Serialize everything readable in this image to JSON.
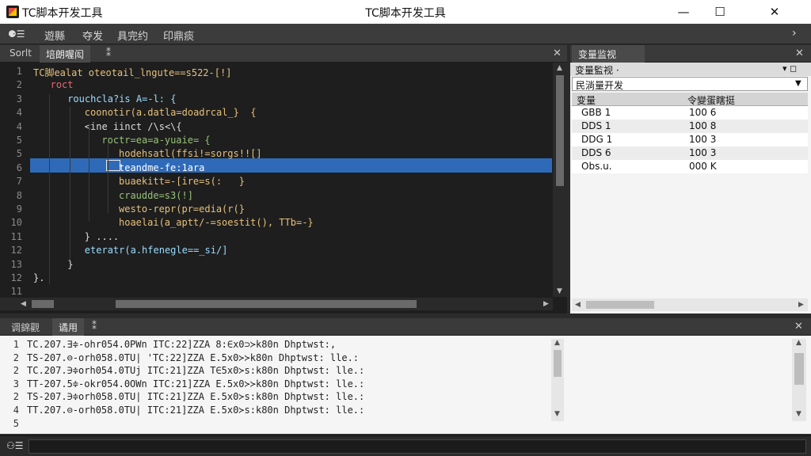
{
  "window": {
    "title_left": "TC脚本开发工具",
    "title_center": "TC脚本开发工具",
    "min_glyph": "—",
    "max_glyph": "☐",
    "close_glyph": "✕"
  },
  "menu": {
    "icon_glyph": "⚈☰",
    "items": [
      "遊縣",
      "夺发",
      "具完约",
      "印鼎痰"
    ],
    "more_glyph": "›"
  },
  "editor": {
    "tabs": [
      "Sorlt",
      "培朗喔闳"
    ],
    "tab_extra": "⁑",
    "close_glyph": "✕",
    "line_numbers": [
      "1",
      "2",
      "3",
      "4",
      "4",
      "5",
      "5",
      "6",
      "7",
      "8",
      "9",
      "10",
      "11",
      "12",
      "13",
      "12",
      "11",
      "21"
    ],
    "lines": [
      {
        "text": "TC脚ealat oteotail_lngute==s522-[!]",
        "indent": 0,
        "color": "#e6c07b"
      },
      {
        "text": "roct",
        "indent": 2,
        "color": "#e06c75"
      },
      {
        "text": "rouchcla?is A=-l: {",
        "indent": 4,
        "color": "#9cdcfe"
      },
      {
        "text": "coonotir(a.datla=doadrcal_}  {",
        "indent": 6,
        "color": "#e6c07b"
      },
      {
        "text": "<ine iinct /\\s<\\{",
        "indent": 6,
        "color": "#ddd"
      },
      {
        "text": "roctr=ea=a-yuaie= {",
        "indent": 8,
        "color": "#98c379"
      },
      {
        "text": "hodehsatl(ffsi!=sorgs!![]",
        "indent": 10,
        "color": "#e6c07b"
      },
      {
        "text": "teandme-fe:1ara",
        "indent": 10,
        "color": "#ffffff"
      },
      {
        "text": "buaekitt=-[ire=s(:   }",
        "indent": 10,
        "color": "#e6c07b"
      },
      {
        "text": "craudde=s3(!]",
        "indent": 10,
        "color": "#98c379"
      },
      {
        "text": "westo-repr(pr=edia(r(}",
        "indent": 10,
        "color": "#e6c07b"
      },
      {
        "text": "hoaelai(a_aptt/-=soestit(), TTb=-}",
        "indent": 10,
        "color": "#e6c07b"
      },
      {
        "text": "} ....",
        "indent": 6,
        "color": "#ddd"
      },
      {
        "text": "eteratr(a.hfenegle==_si/]",
        "indent": 6,
        "color": "#9cdcfe"
      },
      {
        "text": "}",
        "indent": 4,
        "color": "#ddd"
      },
      {
        "text": "}.",
        "indent": 0,
        "color": "#ddd"
      },
      {
        "text": "",
        "indent": 0,
        "color": "#ddd"
      },
      {
        "text": "",
        "indent": 0,
        "color": "#ddd"
      }
    ]
  },
  "variables": {
    "tab_title": "变量监视",
    "close_glyph": "✕",
    "header_label": "变量監视 ·",
    "header_pin": "▾ ◻",
    "selected": "民淌量开发",
    "columns": [
      "变量",
      "令變蛋瞎挺"
    ],
    "rows": [
      [
        "GBB 1",
        "100 6"
      ],
      [
        "DDS 1",
        "100 8"
      ],
      [
        "DDG 1",
        "100 3"
      ],
      [
        "DDS 6",
        "100 3"
      ],
      [
        "Obs.u.",
        "000 K"
      ]
    ]
  },
  "log": {
    "tabs": [
      "调錦觀",
      "谲用"
    ],
    "tab_extra": "⁑",
    "close_glyph": "✕",
    "line_numbers": [
      "1",
      "2",
      "2",
      "3",
      "2",
      "4",
      "5"
    ],
    "lines": [
      "TC.207.∃≑-ohr054.0PWn ITC:22]ZZA 8:∈x0⊃≻k80n Dhptwst:,",
      "TS-207.⊖-orh058.0TU| 'TC:22]ZZA E.5x0≻≻k80n Dhptwst: lle.:",
      "TC.207.∋≑orh054.0TUj ITC:21]ZZA T∈5x0≻s:k80n Dhptwst: lle.:",
      "TT-207.5≑-okr054.0OWn ITC:21]ZZA E.5x0≻≻k80n Dhptwst: lle.:",
      "TS-207.∋≑orh058.0TU| ITC:21]ZZA E.5x0≻s:k80n Dhptwst: lle.:",
      "TT.207.⊖-orh058.0TU| ITC:21]ZZA E.5x0≻s:k80n Dhptwst: lle.:"
    ]
  },
  "status": {
    "icon_glyph": "⚇☰"
  }
}
